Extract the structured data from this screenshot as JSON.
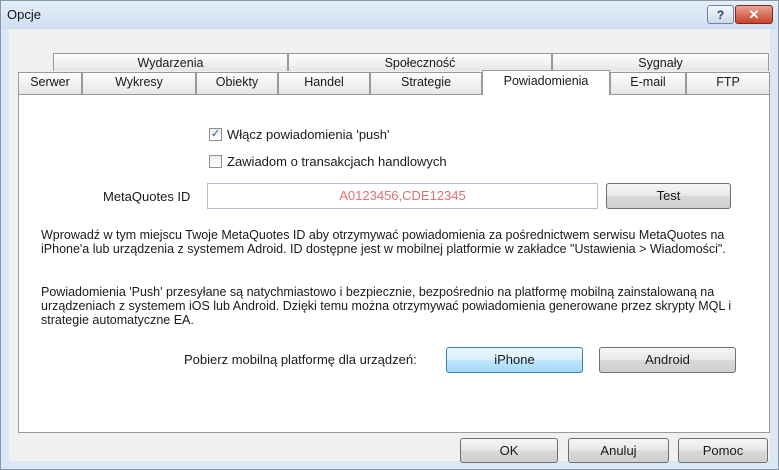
{
  "window": {
    "title": "Opcje",
    "help_glyph": "?",
    "close_glyph": "✕"
  },
  "tabs_row1": [
    "Wydarzenia",
    "Społeczność",
    "Sygnały"
  ],
  "tabs_row2": [
    "Serwer",
    "Wykresy",
    "Obiekty",
    "Handel",
    "Strategie",
    "Powiadomienia",
    "E-mail",
    "FTP"
  ],
  "active_tab": "Powiadomienia",
  "notifications": {
    "enable_push": {
      "label": "Włącz powiadomienia 'push'",
      "checked": true,
      "check_glyph": "✓"
    },
    "notify_trades": {
      "label": "Zawiadom o transakcjach handlowych",
      "checked": false
    },
    "metaquotes_label": "MetaQuotes ID",
    "metaquotes_value": "A0123456,CDE12345",
    "test_button": "Test",
    "description1": "Wprowadź w tym miejscu Twoje MetaQuotes ID aby otrzymywać powiadomienia za pośrednictwem serwisu MetaQuotes na iPhone'a lub urządzenia z systemem Adroid. ID dostępne jest w mobilnej platformie w zakładce \"Ustawienia > Wiadomości\".",
    "description2": "Powiadomienia 'Push' przesyłane są natychmiastowo i bezpiecznie, bezpośrednio na platformę mobilną zainstalowaną na urządzeniach z systemem iOS lub Android. Dzięki temu można otrzymywać powiadomienia generowane przez skrypty MQL i strategie automatyczne EA.",
    "download_label": "Pobierz mobilną platformę dla urządzeń:",
    "iphone_button": "iPhone",
    "android_button": "Android"
  },
  "footer": {
    "ok": "OK",
    "cancel": "Anuluj",
    "help": "Pomoc"
  }
}
